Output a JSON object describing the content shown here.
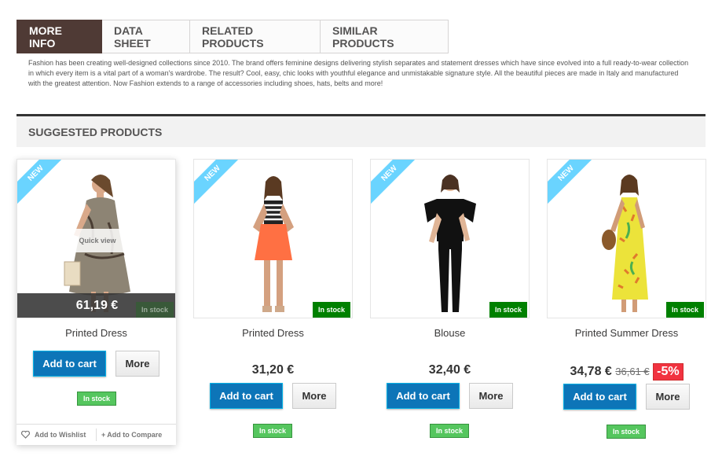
{
  "tabs": [
    {
      "label": "More info"
    },
    {
      "label": "Data sheet"
    },
    {
      "label": "Related products"
    },
    {
      "label": "Similar products"
    }
  ],
  "description": "Fashion has been creating well-designed collections since 2010. The brand offers feminine designs delivering stylish separates and statement dresses which have since evolved into a full ready-to-wear collection in which every item is a vital part of a woman's wardrobe. The result? Cool, easy, chic looks with youthful elegance and unmistakable signature style. All the beautiful pieces are made in Italy and manufactured with the greatest attention. Now Fashion extends to a range of accessories including shoes, hats, belts and more!",
  "section_title": "Suggested products",
  "colors": {
    "accent": "#4f3a35",
    "cart": "#0d75b8",
    "new": "#6ad4ff",
    "stock": "#008000",
    "discount": "#f13340"
  },
  "products": [
    {
      "name": "Printed Dress",
      "ribbon": "New",
      "quick_view": "Quick view",
      "price": "61,19 €",
      "stock_tag": "In stock",
      "add_to_cart": "Add to cart",
      "more": "More",
      "availability": "In stock",
      "wishlist": "Add to Wishlist",
      "compare": "Add to Compare",
      "icon": "heart-icon"
    },
    {
      "name": "Printed Dress",
      "ribbon": "New",
      "price": "31,20 €",
      "stock_tag": "In stock",
      "add_to_cart": "Add to cart",
      "more": "More",
      "availability": "In stock"
    },
    {
      "name": "Blouse",
      "ribbon": "New",
      "price": "32,40 €",
      "stock_tag": "In stock",
      "add_to_cart": "Add to cart",
      "more": "More",
      "availability": "In stock"
    },
    {
      "name": "Printed Summer Dress",
      "ribbon": "New",
      "price": "34,78 €",
      "old_price": "36,61 €",
      "discount": "-5%",
      "stock_tag": "In stock",
      "add_to_cart": "Add to cart",
      "more": "More",
      "availability": "In stock"
    }
  ]
}
